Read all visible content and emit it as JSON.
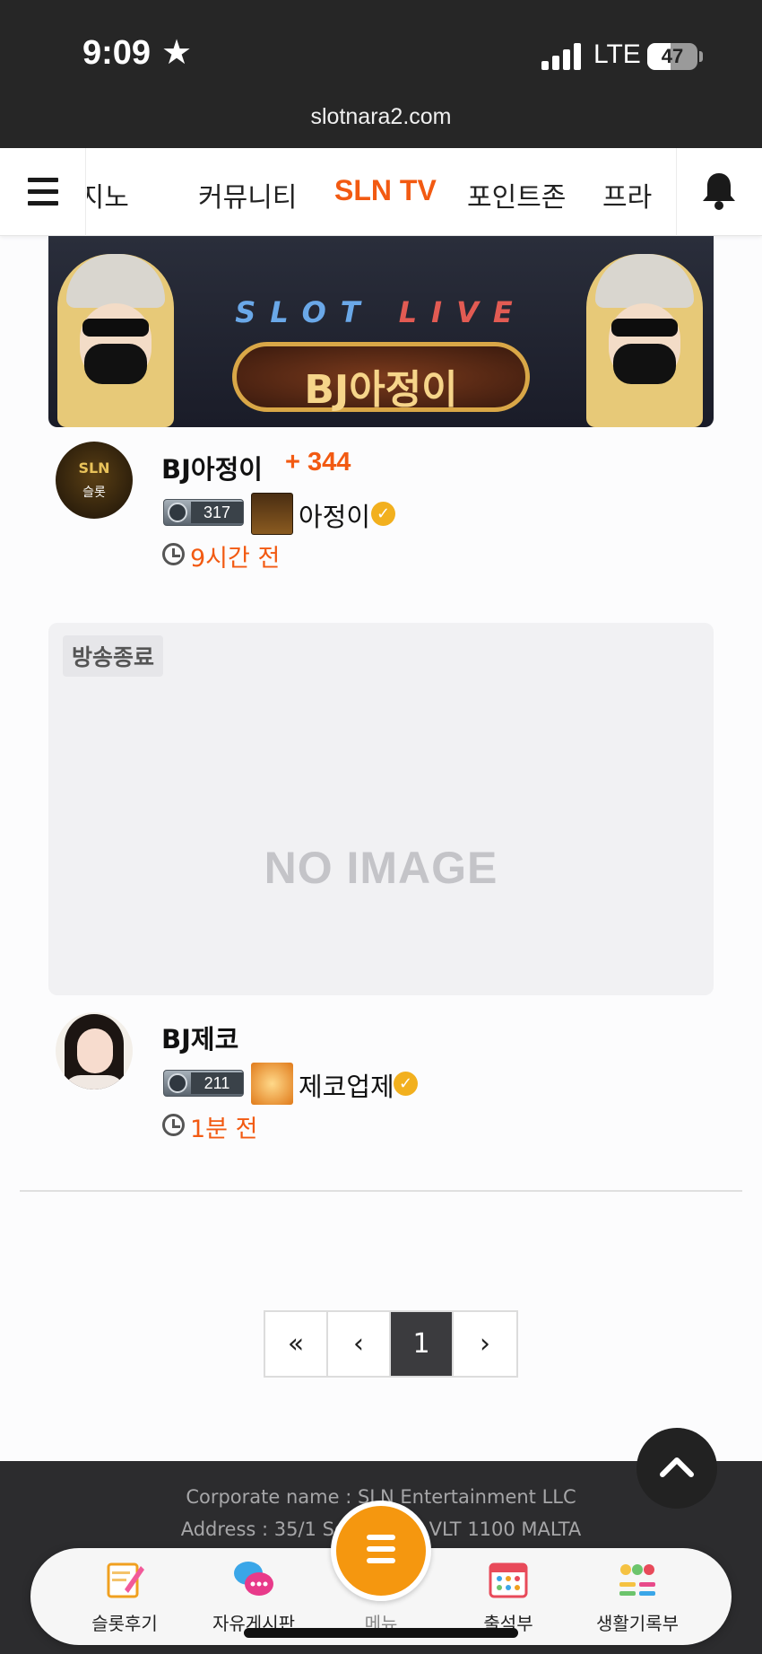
{
  "status_bar": {
    "time": "9:09",
    "network": "LTE",
    "battery": "47",
    "battery_level": 0.47
  },
  "browser": {
    "url": "slotnara2.com"
  },
  "nav": {
    "tabs": [
      {
        "label": "카지노"
      },
      {
        "label": "커뮤니티"
      },
      {
        "label": "SLN TV"
      },
      {
        "label": "포인트존"
      },
      {
        "label": "프라"
      }
    ],
    "active_tab": "SLN TV"
  },
  "streams": [
    {
      "thumb_title": "BJ아정이",
      "thumb_caption_left": "SLOT",
      "thumb_caption_right": "LIVE",
      "avatar_text": "SLN",
      "avatar_sub": "슬롯",
      "name": "BJ아정이",
      "viewers": "+ 344",
      "level": "317",
      "nickname": "아정이",
      "time_ago": "9시간 전"
    },
    {
      "status_badge": "방송종료",
      "no_image": "NO IMAGE",
      "name": "BJ제코",
      "level": "211",
      "nickname": "제코업제",
      "time_ago": "1분 전"
    }
  ],
  "pagination": {
    "first": "«",
    "prev": "‹",
    "current": "1",
    "next": "›"
  },
  "footer": {
    "line1": "Corporate name : SLN Entertainment LLC",
    "line2": "Address : 35/1 Sou",
    "line2_tail": "a VLT 1100 MALTA"
  },
  "dock": {
    "items": [
      {
        "label": "슬롯후기",
        "icon": "notepad-pencil-icon"
      },
      {
        "label": "자유게시판",
        "icon": "chat-bubbles-icon"
      },
      {
        "label": "출석부",
        "icon": "calendar-icon"
      },
      {
        "label": "생활기록부",
        "icon": "emoji-list-icon"
      }
    ],
    "center_label": "메뉴"
  },
  "colors": {
    "accent": "#f25a12",
    "dock_center": "#f5970f",
    "verified": "#f2b01e"
  }
}
